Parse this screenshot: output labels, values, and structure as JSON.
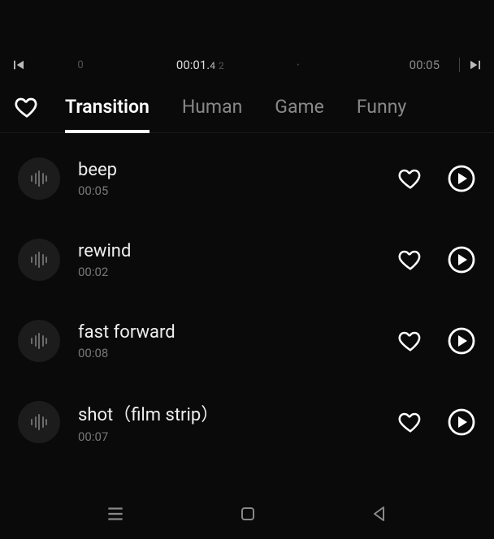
{
  "timeline": {
    "mark_zero": "0",
    "current_time": "00:01.",
    "current_frac": "4",
    "current_suffix": "2",
    "end_time": "00:05"
  },
  "tabs": [
    {
      "label": "Transition",
      "active": true
    },
    {
      "label": "Human",
      "active": false
    },
    {
      "label": "Game",
      "active": false
    },
    {
      "label": "Funny",
      "active": false
    }
  ],
  "sounds": [
    {
      "title": "beep",
      "duration": "00:05"
    },
    {
      "title": "rewind",
      "duration": "00:02"
    },
    {
      "title": "fast forward",
      "duration": "00:08"
    },
    {
      "title": "shot（film strip）",
      "duration": "00:07"
    }
  ]
}
